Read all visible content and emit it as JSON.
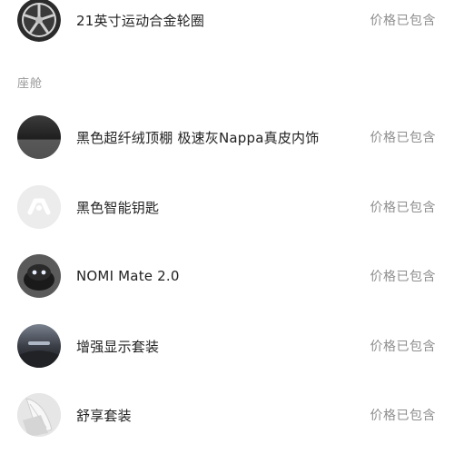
{
  "sections": [
    {
      "items": [
        {
          "title": "21英寸运动合金轮圈",
          "note": "价格已包含",
          "icon": "wheel-rim-icon"
        }
      ]
    },
    {
      "title": "座舱",
      "items": [
        {
          "title": "黑色超纤绒顶棚 极速灰Nappa真皮内饰",
          "note": "价格已包含",
          "icon": "headliner-icon"
        },
        {
          "title": "黑色智能钥匙",
          "note": "价格已包含",
          "icon": "smart-key-icon"
        },
        {
          "title": "NOMI Mate 2.0",
          "note": "价格已包含",
          "icon": "nomi-robot-icon"
        },
        {
          "title": "增强显示套装",
          "note": "价格已包含",
          "icon": "display-pack-icon"
        },
        {
          "title": "舒享套装",
          "note": "价格已包含",
          "icon": "comfort-seat-icon"
        }
      ]
    }
  ]
}
